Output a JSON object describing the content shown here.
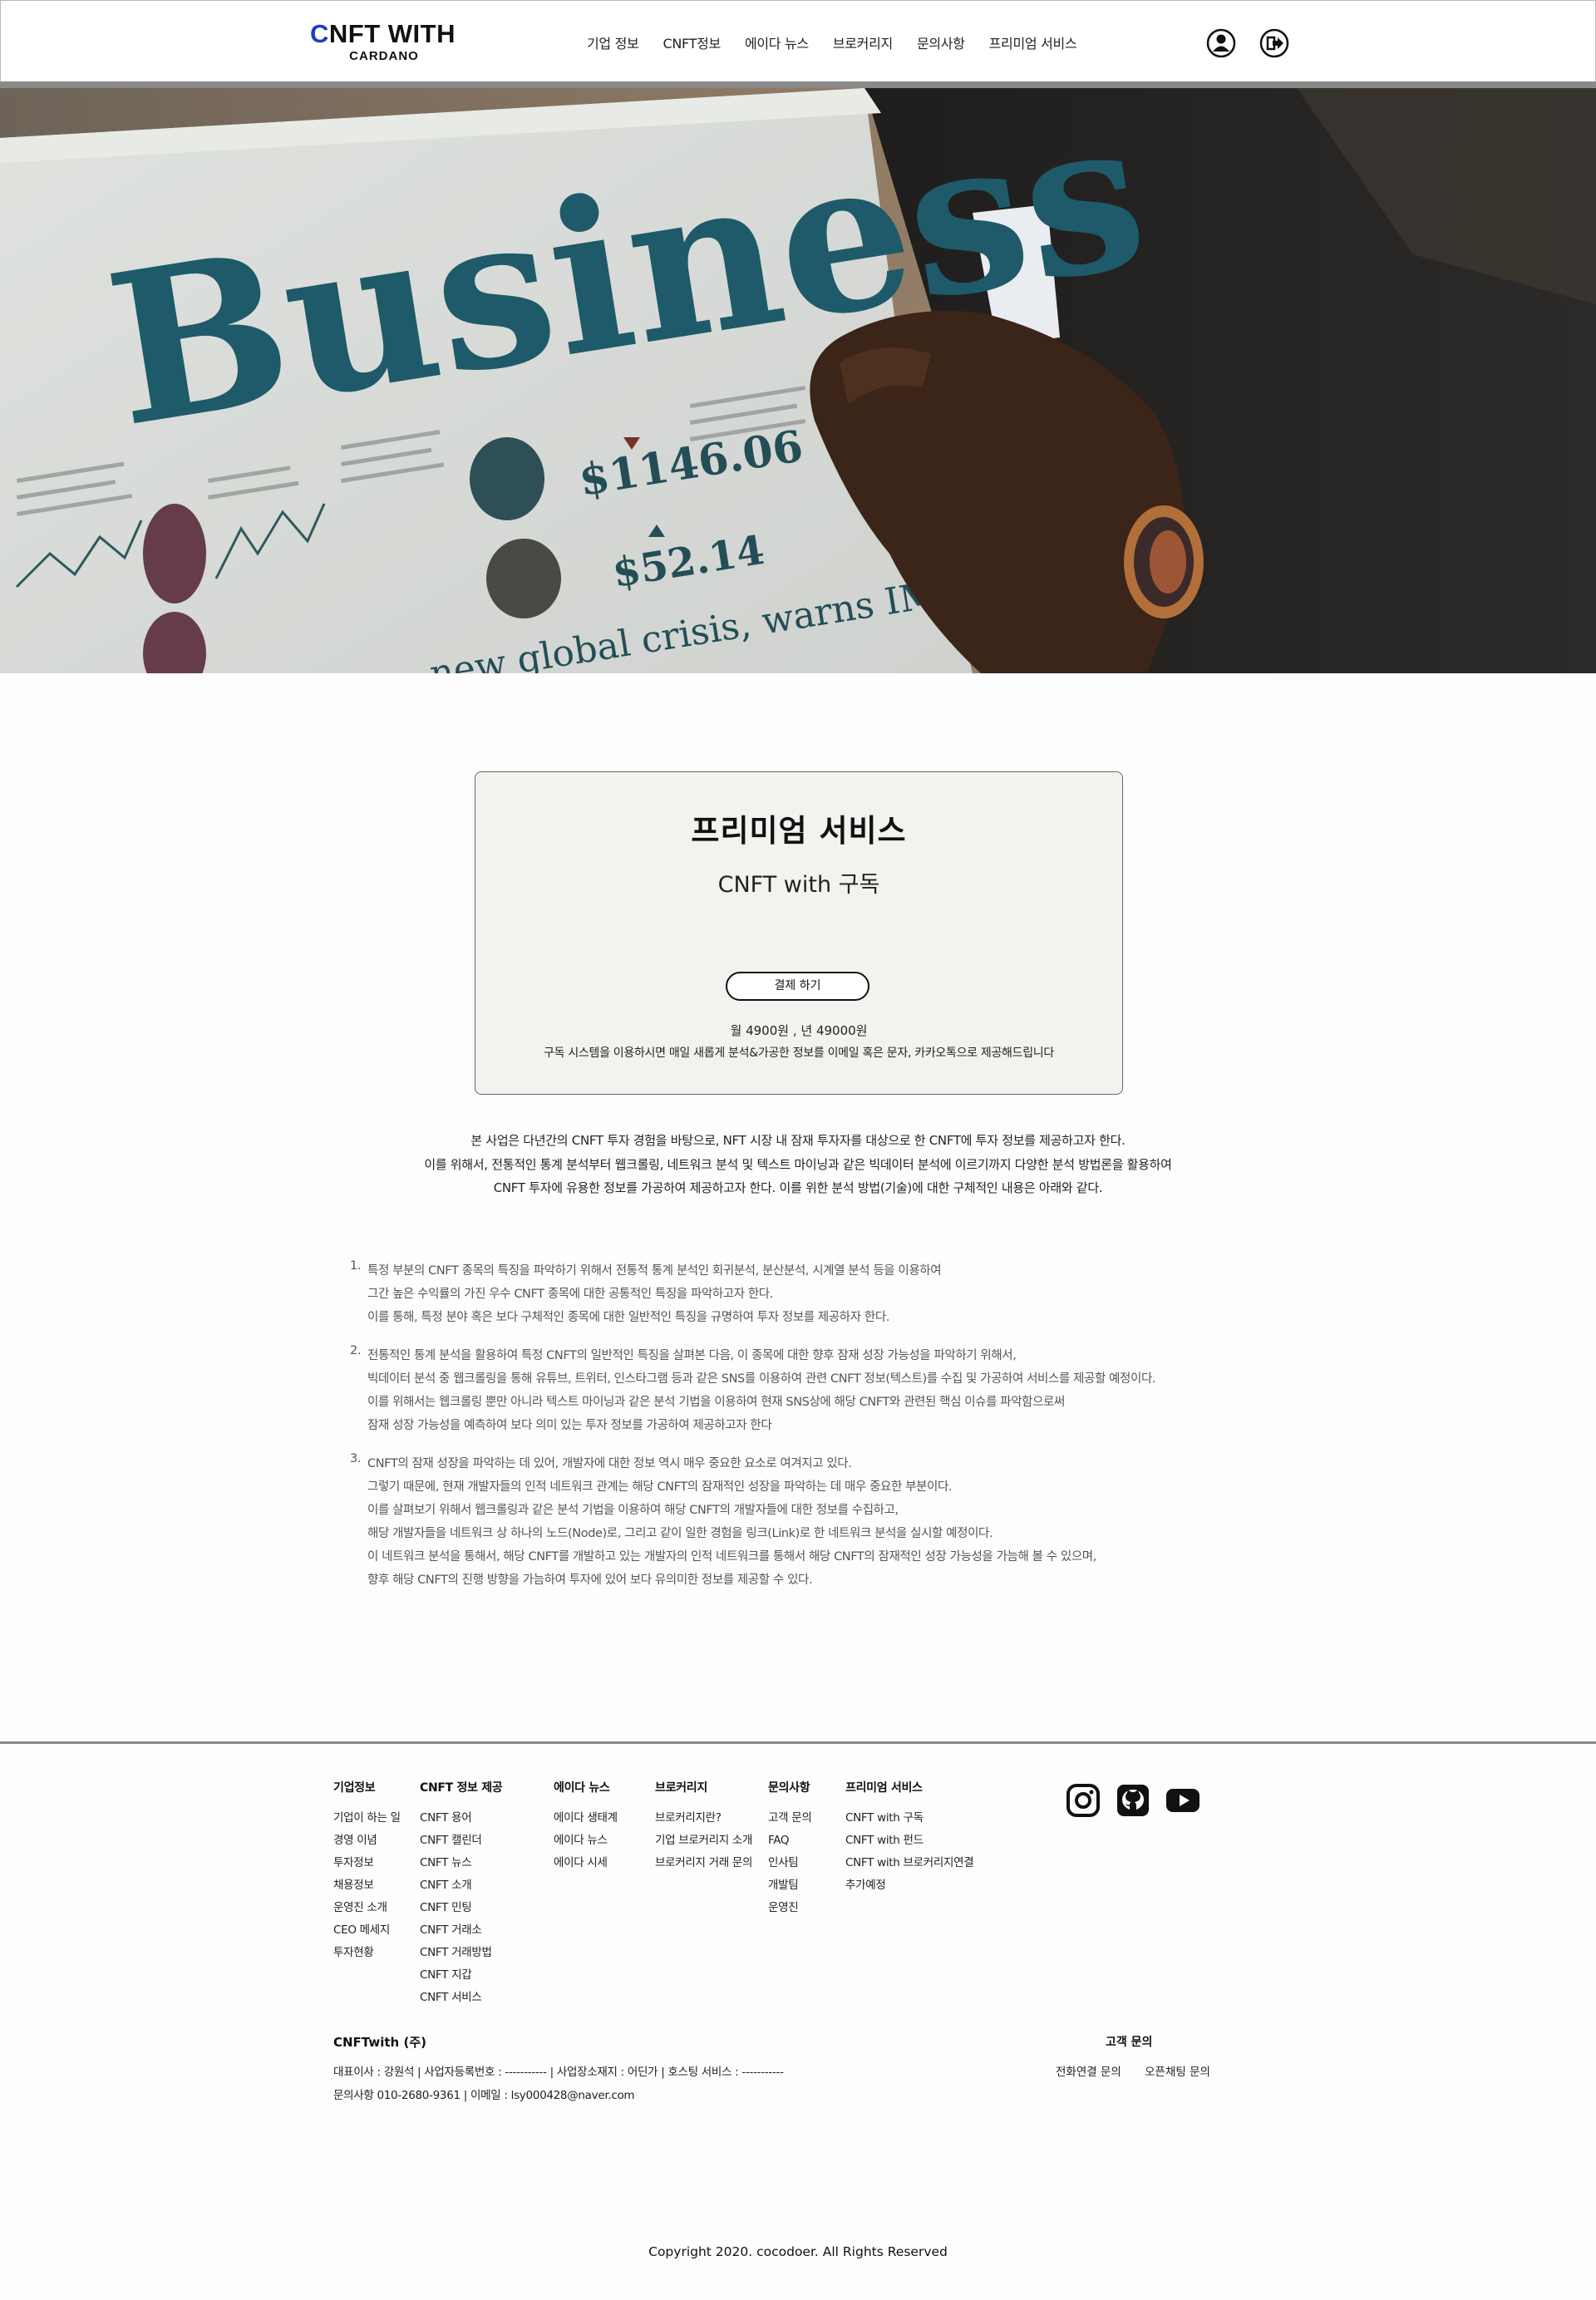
{
  "header": {
    "logo_main_accent": "C",
    "logo_main_rest": "NFT WITH",
    "logo_sub": "CARDANO",
    "nav": [
      {
        "label": "기업 정보"
      },
      {
        "label": "CNFT정보"
      },
      {
        "label": "에이다 뉴스"
      },
      {
        "label": "브로커리지"
      },
      {
        "label": "문의사항"
      },
      {
        "label": "프리미엄 서비스"
      }
    ],
    "icons": [
      "user-icon",
      "logout-icon"
    ]
  },
  "hero": {
    "headline": "Business",
    "price_1": "$1146.06",
    "price_2": "$52.14",
    "caption": "new global crisis, warns IMF"
  },
  "premium": {
    "title": "프리미엄 서비스",
    "subtitle": "CNFT with 구독",
    "button": "결제 하기",
    "price": "월 4900원 , 년 49000원",
    "description": "구독 시스템을 이용하시면 매일 새롭게 분석&가공한 정보를 이메일 혹은 문자, 카카오톡으로 제공해드립니다"
  },
  "intro": [
    "본 사업은 다년간의 CNFT 투자 경험을 바탕으로, NFT 시장 내 잠재 투자자를 대상으로 한 CNFT에 투자 정보를 제공하고자 한다.",
    "이를 위해서, 전통적인 통계 분석부터 웹크롤링, 네트워크 분석 및 텍스트 마이닝과 같은 빅데이터 분석에 이르기까지 다양한 분석 방법론을 활용하여",
    "CNFT 투자에 유용한 정보를 가공하여 제공하고자 한다. 이를 위한 분석 방법(기술)에 대한 구체적인 내용은 아래와 같다."
  ],
  "methods": [
    {
      "num": "1.",
      "lines": [
        "특정 부분의 CNFT 종목의 특징을 파악하기 위해서 전통적 통계 분석인 회귀분석, 분산분석, 시계열 분석 등을 이용하여",
        "그간 높은 수익률의 가진 우수 CNFT 종목에 대한 공통적인 특징을 파악하고자 한다.",
        "이를 통해, 특정 분야 혹은 보다 구체적인 종목에 대한 일반적인 특징을 규명하여 투자 정보를 제공하자 한다."
      ]
    },
    {
      "num": "2.",
      "lines": [
        "전통적인 통계 분석을 활용하여 특정 CNFT의 일반적인 특징을 살펴본 다음, 이 종목에 대한 향후 잠재 성장 가능성을 파악하기 위해서,",
        "빅데이터 분석 중 웹크롤링을 통해 유튜브, 트위터, 인스타그램 등과 같은 SNS를 이용하여 관련 CNFT 정보(텍스트)를 수집 및 가공하여 서비스를 제공할 예정이다.",
        "이를 위해서는 웹크롤링 뿐만 아니라 텍스트 마이닝과 같은 분석 기법을 이용하여 현재 SNS상에 해당 CNFT와 관련된 핵심 이슈를 파악함으로써",
        "잠재 성장 가능성을 예측하여 보다 의미 있는 투자 정보를 가공하여 제공하고자 한다"
      ]
    },
    {
      "num": "3.",
      "lines": [
        "CNFT의 잠재 성장을 파악하는 데 있어, 개발자에 대한 정보 역시 매우 중요한 요소로 여겨지고 있다.",
        "그렇기 때문에, 현재 개발자들의 인적 네트워크 관계는 해당 CNFT의 잠재적인 성장을 파악하는 데 매우 중요한 부분이다.",
        "이를 살펴보기 위해서 웹크롤링과 같은 분석 기법을 이용하여 해당 CNFT의 개발자들에 대한 정보를 수집하고,",
        "해당 개발자들을 네트워크 상 하나의 노드(Node)로, 그리고 같이 일한 경험을 링크(Link)로 한 네트워크 분석을 실시할 예정이다.",
        "이 네트워크 분석을 통해서, 해당 CNFT를 개발하고 있는 개발자의 인적 네트워크를 통해서 해당 CNFT의 잠재적인 성장 가능성을 가늠해 볼 수 있으며,",
        "향후 해당 CNFT의 진행 방향을 가늠하여 투자에 있어 보다 유의미한 정보를 제공할 수 있다."
      ]
    }
  ],
  "footer": {
    "columns": [
      {
        "title": "기업정보",
        "items": [
          "기업이 하는 일",
          "경영 이념",
          "투자정보",
          "채용정보",
          "운영진 소개",
          "CEO 메세지",
          "투자현황"
        ]
      },
      {
        "title": "CNFT 정보 제공",
        "items": [
          "CNFT 용어",
          "CNFT 캘린더",
          "CNFT 뉴스",
          "CNFT 소개",
          "CNFT 민팅",
          "CNFT 거래소",
          "CNFT 거래방법",
          "CNFT 지갑",
          "CNFT 서비스"
        ]
      },
      {
        "title": "에이다 뉴스",
        "items": [
          "에이다 생태계",
          "에이다 뉴스",
          "에이다 시세"
        ]
      },
      {
        "title": "브로커리지",
        "items": [
          "브로커리지란?",
          "기업 브로커리지 소개",
          "브로커리지 거래 문의"
        ]
      },
      {
        "title": "문의사항",
        "items": [
          "고객 문의",
          "FAQ",
          "인사팀",
          "개발팀",
          "운영진"
        ]
      },
      {
        "title": "프리미엄 서비스",
        "items": [
          "CNFT with 구독",
          "CNFT with 펀드",
          "CNFT with 브로커리지연결",
          "추가예정"
        ]
      }
    ],
    "social": [
      "instagram-icon",
      "github-icon",
      "youtube-icon"
    ],
    "company_name": "CNFTwith (주)",
    "company_line_1": "대표이사 : 강원석   |   사업자등록번호 : -----------   |   사업장소재지 : 어딘가   |   호스팅 서비스 : -----------",
    "company_line_2": "문의사항  010-2680-9361   |   이메일 : lsy000428@naver.com",
    "cs_title": "고객 문의",
    "cs_links": [
      "전화연결 문의",
      "오픈채팅 문의"
    ],
    "copyright": "Copyright 2020. cocodoer. All Rights Reserved"
  }
}
